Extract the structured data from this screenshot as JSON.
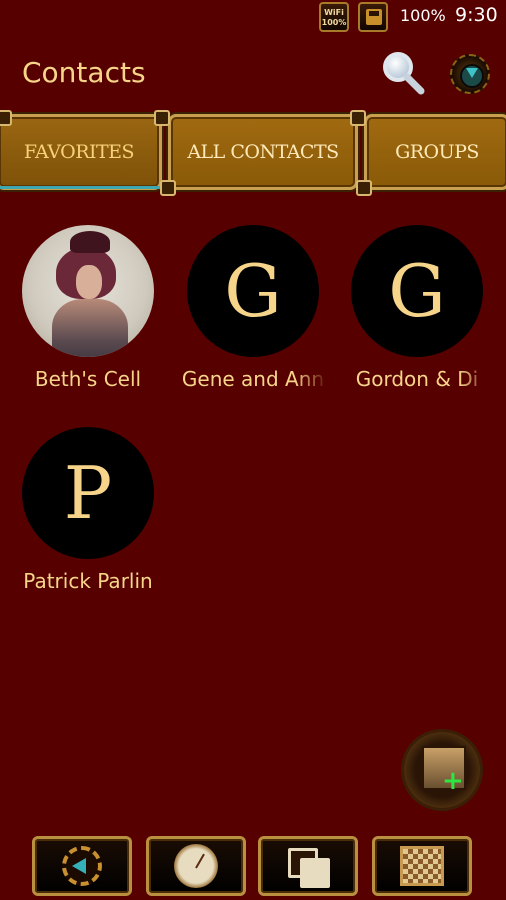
{
  "status_bar": {
    "wifi_label": "WiFi",
    "wifi_level": "100%",
    "battery": "100%",
    "time": "9:30"
  },
  "header": {
    "title": "Contacts",
    "icons": [
      "search-icon",
      "gear-menu-icon"
    ]
  },
  "tabs": [
    {
      "label": "FAVORITES",
      "selected": true
    },
    {
      "label": "ALL CONTACTS",
      "selected": false
    },
    {
      "label": "GROUPS",
      "selected": false
    }
  ],
  "favorites": [
    {
      "name": "Beth's Cell",
      "avatar": "photo",
      "initial": ""
    },
    {
      "name": "Gene and Ann",
      "avatar": "letter",
      "initial": "G"
    },
    {
      "name": "Gordon & Di",
      "avatar": "letter",
      "initial": "G"
    },
    {
      "name": "Patrick Parlin",
      "avatar": "letter",
      "initial": "P"
    }
  ],
  "fab": {
    "icon": "add-contact-icon"
  },
  "bottom_nav": {
    "icons": [
      "back-icon",
      "home-gauge-icon",
      "recent-apps-icon",
      "app-grid-icon"
    ]
  },
  "colors": {
    "background": "#570000",
    "accent_text": "#f6d58a",
    "tab_fill": "#8a5a08",
    "tab_border": "#c9a050",
    "tab_indicator": "#3da8b0"
  }
}
